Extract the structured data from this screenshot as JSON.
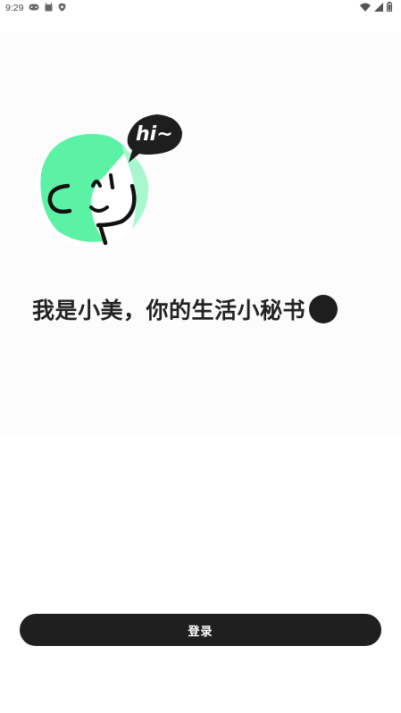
{
  "status_bar": {
    "time": "9:29",
    "left_icons": [
      "gamepad-icon",
      "android-icon",
      "shield-icon"
    ],
    "right_icons": [
      "wifi-icon",
      "signal-icon",
      "battery-icon"
    ]
  },
  "hero": {
    "bubble_text": "hi~",
    "greeting": "我是小美，你的生活小秘书"
  },
  "actions": {
    "login_label": "登录"
  },
  "colors": {
    "accent_green": "#5cf2a6",
    "dark": "#1f1f1f",
    "text": "#222222"
  }
}
